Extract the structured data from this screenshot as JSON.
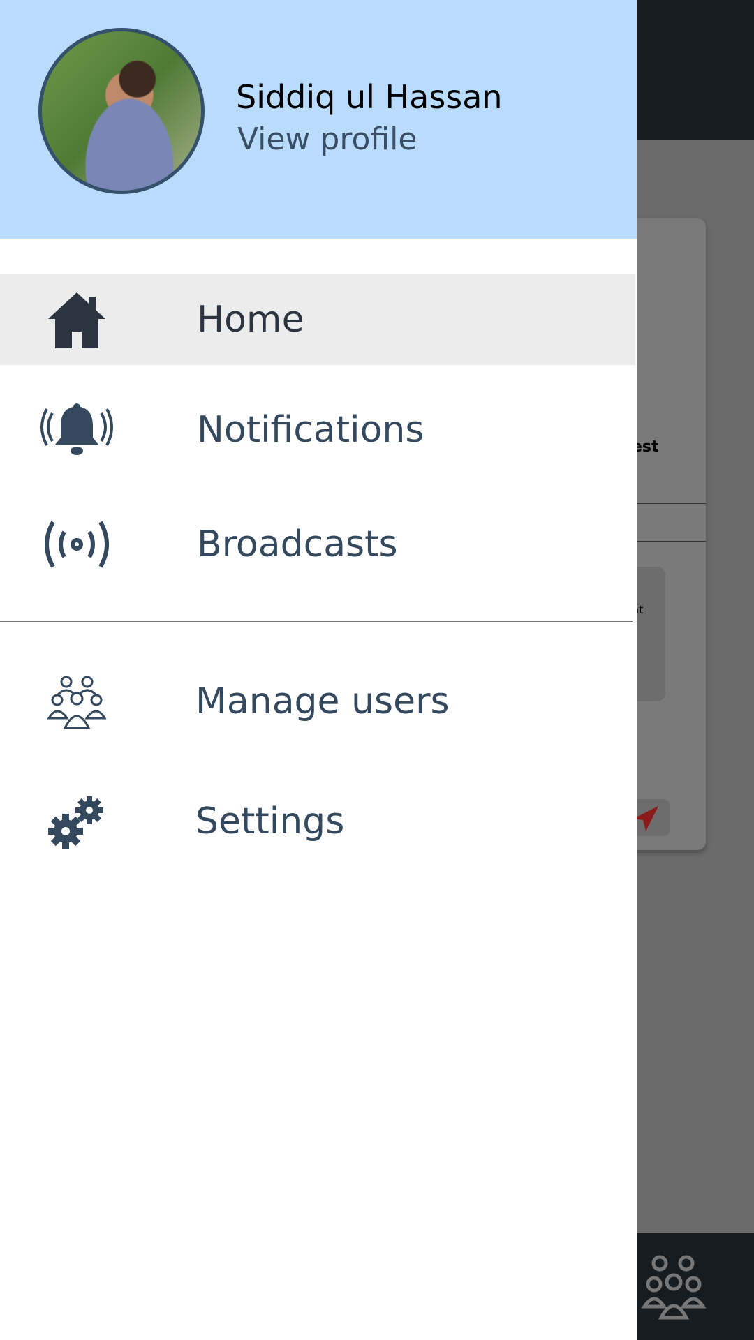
{
  "profile": {
    "name": "Siddiq ul Hassan",
    "link": "View profile"
  },
  "menu": [
    {
      "label": "Home",
      "icon": "home-icon",
      "active": true
    },
    {
      "label": "Notifications",
      "icon": "bell-icon"
    },
    {
      "label": "Broadcasts",
      "icon": "broadcast-icon"
    },
    {
      "label": "Manage users",
      "icon": "users-icon"
    },
    {
      "label": "Settings",
      "icon": "gears-icon"
    }
  ],
  "background": {
    "fragment1": "est",
    "fragment2": "nt"
  },
  "colors": {
    "header": "#b9dcfd",
    "text": "#34495e",
    "active": "#ececec",
    "accent": "#8b1a1a"
  }
}
